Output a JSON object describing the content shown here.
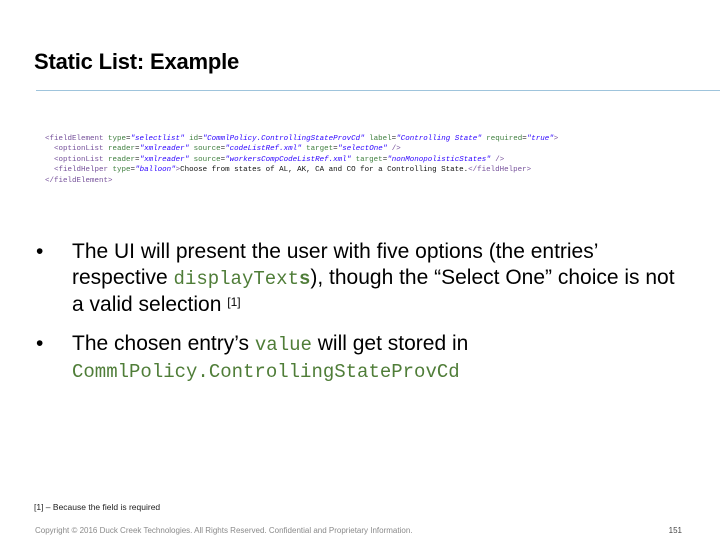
{
  "slide": {
    "title": "Static List: Example",
    "page_number": "151"
  },
  "code": {
    "lines": [
      [
        {
          "t": "tag",
          "v": "<fieldElement "
        },
        {
          "t": "attr",
          "v": "type"
        },
        {
          "t": "eq",
          "v": "="
        },
        {
          "t": "val",
          "v": "\"selectlist\""
        },
        {
          "t": "text",
          "v": " "
        },
        {
          "t": "attr",
          "v": "id"
        },
        {
          "t": "eq",
          "v": "="
        },
        {
          "t": "val",
          "v": "\"CommlPolicy.ControllingStateProvCd\""
        },
        {
          "t": "text",
          "v": " "
        },
        {
          "t": "attr",
          "v": "label"
        },
        {
          "t": "eq",
          "v": "="
        },
        {
          "t": "val",
          "v": "\"Controlling State\""
        },
        {
          "t": "text",
          "v": " "
        },
        {
          "t": "attr",
          "v": "required"
        },
        {
          "t": "eq",
          "v": "="
        },
        {
          "t": "val",
          "v": "\"true\""
        },
        {
          "t": "tag",
          "v": ">"
        }
      ],
      [
        {
          "t": "text",
          "v": "  "
        },
        {
          "t": "tag",
          "v": "<optionList "
        },
        {
          "t": "attr",
          "v": "reader"
        },
        {
          "t": "eq",
          "v": "="
        },
        {
          "t": "val",
          "v": "\"xmlreader\""
        },
        {
          "t": "text",
          "v": " "
        },
        {
          "t": "attr",
          "v": "source"
        },
        {
          "t": "eq",
          "v": "="
        },
        {
          "t": "val",
          "v": "\"codeListRef.xml\""
        },
        {
          "t": "text",
          "v": " "
        },
        {
          "t": "attr",
          "v": "target"
        },
        {
          "t": "eq",
          "v": "="
        },
        {
          "t": "val",
          "v": "\"selectOne\""
        },
        {
          "t": "tag",
          "v": " />"
        }
      ],
      [
        {
          "t": "text",
          "v": "  "
        },
        {
          "t": "tag",
          "v": "<optionList "
        },
        {
          "t": "attr",
          "v": "reader"
        },
        {
          "t": "eq",
          "v": "="
        },
        {
          "t": "val",
          "v": "\"xmlreader\""
        },
        {
          "t": "text",
          "v": " "
        },
        {
          "t": "attr",
          "v": "source"
        },
        {
          "t": "eq",
          "v": "="
        },
        {
          "t": "val",
          "v": "\"workersCompCodeListRef.xml\""
        },
        {
          "t": "text",
          "v": " "
        },
        {
          "t": "attr",
          "v": "target"
        },
        {
          "t": "eq",
          "v": "="
        },
        {
          "t": "val",
          "v": "\"nonMonopolisticStates\""
        },
        {
          "t": "tag",
          "v": " />"
        }
      ],
      [
        {
          "t": "text",
          "v": "  "
        },
        {
          "t": "tag",
          "v": "<fieldHelper "
        },
        {
          "t": "attr",
          "v": "type"
        },
        {
          "t": "eq",
          "v": "="
        },
        {
          "t": "val",
          "v": "\"balloon\""
        },
        {
          "t": "tag",
          "v": ">"
        },
        {
          "t": "text",
          "v": "Choose from states of AL, AK, CA and CO for a Controlling State."
        },
        {
          "t": "tag",
          "v": "</fieldHelper>"
        }
      ],
      [
        {
          "t": "tag",
          "v": "</fieldElement>"
        }
      ]
    ]
  },
  "bullets": [
    {
      "marker": "•",
      "part1": "The UI will present the user with five options (the entries’ respective ",
      "code1": "displayText",
      "code1b": "s",
      "part2": "), though the “Select One” choice is not a valid selection ",
      "ref": "[1]"
    },
    {
      "marker": "•",
      "part1": "The chosen entry’s ",
      "code1": "value",
      "part2": " will get stored in ",
      "code2": "CommlPolicy.ControllingStateProvCd"
    }
  ],
  "footnote": "[1] – Because the field is required",
  "footer": "Copyright © 2016 Duck Creek Technologies. All Rights Reserved. Confidential and Proprietary Information."
}
